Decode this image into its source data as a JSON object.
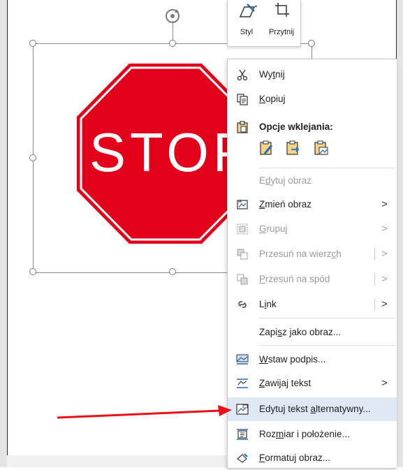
{
  "stop_sign": {
    "text": "STOP",
    "color": "#e2001a"
  },
  "mini_toolbar": {
    "style_label": "Styl",
    "crop_label": "Przytnij"
  },
  "menu": {
    "cut": {
      "pre": "Wy",
      "u": "t",
      "post": "nij"
    },
    "copy": {
      "pre": "",
      "u": "K",
      "post": "opiuj"
    },
    "paste_header": "Opcje wklejania:",
    "edit_image": {
      "pre": "E",
      "u": "d",
      "post": "ytuj obraz"
    },
    "change_image": {
      "pre": "",
      "u": "Z",
      "post": "mień obraz"
    },
    "group": {
      "pre": "",
      "u": "G",
      "post": "rupuj"
    },
    "bring_forward": {
      "pre": "Przesuń na wierz",
      "u": "c",
      "post": "h"
    },
    "send_backward": {
      "pre": "",
      "u": "P",
      "post": "rzesuń na spód"
    },
    "link": {
      "pre": "L",
      "u": "i",
      "post": "nk"
    },
    "save_as_image": {
      "pre": "Zapi",
      "u": "s",
      "post": "z jako obraz..."
    },
    "insert_caption": {
      "pre": "",
      "u": "W",
      "post": "staw podpis..."
    },
    "wrap_text": {
      "pre": "",
      "u": "Z",
      "post": "awijaj tekst"
    },
    "edit_alt_text": {
      "pre": "Edytuj tekst ",
      "u": "a",
      "post": "lternatywny..."
    },
    "size_position": {
      "pre": "Roz",
      "u": "m",
      "post": "iar i położenie..."
    },
    "format_image": {
      "pre": "",
      "u": "F",
      "post": "ormatuj obraz..."
    },
    "submenu_arrow": ">"
  },
  "colors": {
    "accent_arrow": "#e8121a",
    "highlight": "#dfe8f5",
    "icon_blue": "#2b6cb0"
  }
}
